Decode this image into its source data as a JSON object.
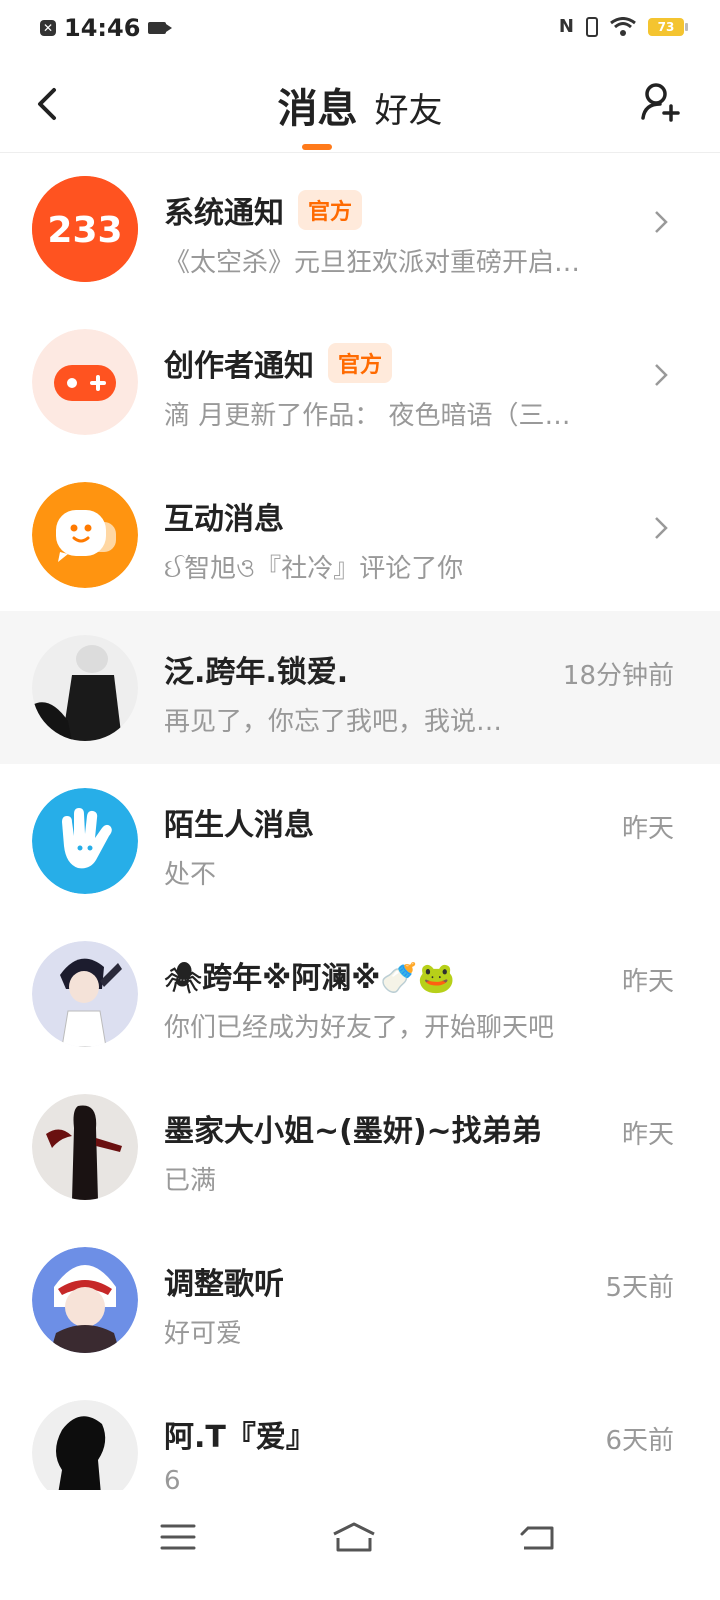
{
  "status_bar": {
    "time": "14:46",
    "battery": "73"
  },
  "header": {
    "tab_messages": "消息",
    "tab_friends": "好友"
  },
  "rows": [
    {
      "name": "系统通知",
      "badge": "官方",
      "preview": "《太空杀》元旦狂欢派对重磅开启…",
      "time": "",
      "avatar_text": "233",
      "avatar_color": "#ff5a1f"
    },
    {
      "name": "创作者通知",
      "badge": "官方",
      "preview": "滴 月更新了作品：  夜色暗语（三…",
      "time": "",
      "avatar_color": "#fde9e2"
    },
    {
      "name": "互动消息",
      "badge": "",
      "preview": "ઈ智旭ও『社冷』评论了你",
      "time": "",
      "avatar_color": "#ff9410"
    },
    {
      "name": "泛.跨年.锁爱.",
      "preview": "再见了，你忘了我吧，我说…",
      "time": "18分钟前"
    },
    {
      "name": "陌生人消息",
      "preview": "处不",
      "time": "昨天",
      "avatar_color": "#27aee8"
    },
    {
      "name": "🕷跨年※阿澜※🍼🐸",
      "preview": "你们已经成为好友了，开始聊天吧",
      "time": "昨天"
    },
    {
      "name": "墨家大小姐~(墨妍)~找弟弟",
      "preview": "已满",
      "time": "昨天"
    },
    {
      "name": "调整歌听",
      "preview": "好可爱",
      "time": "5天前"
    },
    {
      "name": "阿.T『爱』",
      "preview": "6",
      "time": "6天前"
    }
  ],
  "colors": {
    "accent": "#ff7a1a",
    "badge_text": "#ff6a00",
    "badge_bg": "#ffeadb"
  }
}
